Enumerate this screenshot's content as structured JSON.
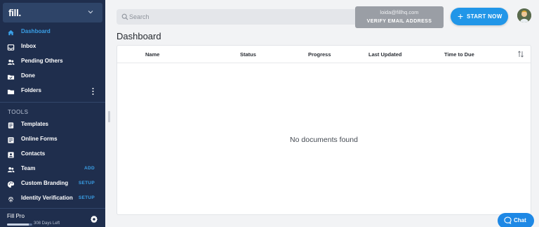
{
  "brand": {
    "logo_text": "fill."
  },
  "sidebar": {
    "primary_items": [
      {
        "label": "Dashboard",
        "icon": "home-icon",
        "active": true
      },
      {
        "label": "Inbox",
        "icon": "inbox-icon"
      },
      {
        "label": "Pending Others",
        "icon": "people-icon"
      },
      {
        "label": "Done",
        "icon": "done-folder-icon"
      },
      {
        "label": "Folders",
        "icon": "folder-icon",
        "menu": "kebab-menu-icon"
      }
    ],
    "section_title": "TOOLS",
    "tool_items": [
      {
        "label": "Templates",
        "icon": "templates-icon"
      },
      {
        "label": "Online Forms",
        "icon": "forms-icon"
      },
      {
        "label": "Contacts",
        "icon": "contacts-icon"
      },
      {
        "label": "Team",
        "icon": "team-icon",
        "action": "ADD"
      },
      {
        "label": "Custom Branding",
        "icon": "palette-icon",
        "action": "SETUP"
      },
      {
        "label": "Identity Verification",
        "icon": "fingerprint-icon",
        "action": "SETUP"
      }
    ],
    "plan": {
      "name": "Fill Pro",
      "days_left": "308 Days Left",
      "progress": 0.85
    }
  },
  "search": {
    "placeholder": "Search"
  },
  "verify": {
    "email": "loida@fillhq.com",
    "cta": "VERIFY EMAIL ADDRESS"
  },
  "start_button": {
    "label": "START NOW"
  },
  "main": {
    "title": "Dashboard",
    "columns": [
      "Name",
      "Status",
      "Progress",
      "Last Updated",
      "Time to Due"
    ],
    "empty_message": "No documents found"
  },
  "chat": {
    "label": "Chat"
  },
  "colors": {
    "sidebar_bg": "#1f2e4d",
    "accent": "#2196e8",
    "active_nav": "#3aa0e8"
  }
}
